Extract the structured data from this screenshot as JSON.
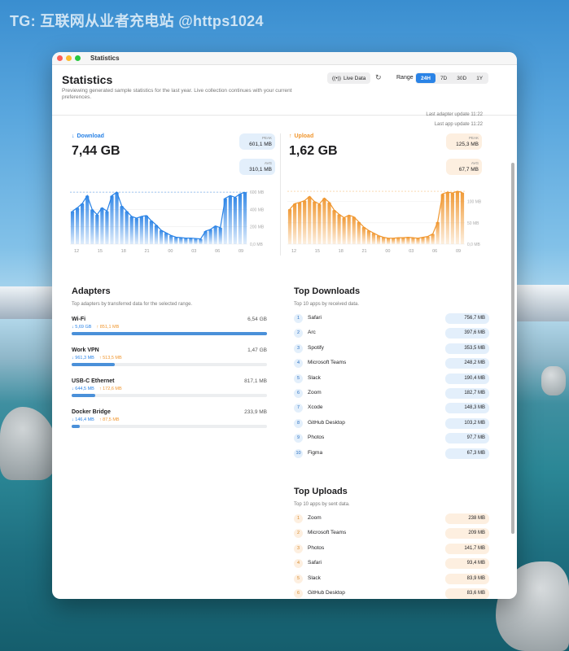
{
  "watermark": "TG: 互联网从业者充电站 @https1024",
  "window": {
    "title": "Statistics"
  },
  "header": {
    "title": "Statistics",
    "desc": "Previewing generated sample statistics for the last year. Live collection continues with your current preferences.",
    "live_label": "Live Data",
    "range_label": "Range",
    "ranges": [
      "24H",
      "7D",
      "30D",
      "1Y"
    ],
    "active_range": "24H",
    "last_adapter": "Last adapter update 11:22",
    "last_app": "Last app update 11:22"
  },
  "download": {
    "label": "Download",
    "total": "7,44 GB",
    "peak_label": "PEAK",
    "peak": "601,1 MB",
    "avg_label": "AVG",
    "avg": "310,1 MB",
    "y_ticks": [
      "600 MB",
      "400 MB",
      "200 MB",
      "0,0 MB"
    ],
    "x_ticks": [
      "12",
      "15",
      "18",
      "21",
      "00",
      "03",
      "06",
      "09"
    ],
    "values": [
      380,
      420,
      470,
      560,
      400,
      340,
      420,
      380,
      560,
      600,
      440,
      380,
      320,
      300,
      320,
      330,
      270,
      220,
      160,
      130,
      100,
      80,
      75,
      70,
      70,
      65,
      60,
      150,
      170,
      210,
      190,
      530,
      560,
      540,
      580,
      600
    ]
  },
  "upload": {
    "label": "Upload",
    "total": "1,62 GB",
    "peak_label": "PEAK",
    "peak": "125,3 MB",
    "avg_label": "AVG",
    "avg": "67,7 MB",
    "y_ticks": [
      "100 MB",
      "50 MB",
      "0,0 MB"
    ],
    "x_ticks": [
      "12",
      "15",
      "18",
      "21",
      "00",
      "03",
      "06",
      "09"
    ],
    "values": [
      82,
      95,
      98,
      102,
      112,
      100,
      94,
      108,
      98,
      80,
      70,
      62,
      68,
      64,
      52,
      40,
      32,
      26,
      20,
      16,
      14,
      14,
      15,
      15,
      16,
      15,
      14,
      16,
      18,
      24,
      52,
      118,
      122,
      120,
      124,
      121
    ]
  },
  "adapters": {
    "title": "Adapters",
    "sub": "Top adapters by transferred data for the selected range.",
    "items": [
      {
        "name": "Wi-Fi",
        "total": "6,54 GB",
        "down": "5,69 GB",
        "up": "851,1 MB",
        "fill": 1.0
      },
      {
        "name": "Work VPN",
        "total": "1,47 GB",
        "down": "961,3 MB",
        "up": "513,5 MB",
        "fill": 0.22
      },
      {
        "name": "USB-C Ethernet",
        "total": "817,1 MB",
        "down": "644,5 MB",
        "up": "172,6 MB",
        "fill": 0.12
      },
      {
        "name": "Docker Bridge",
        "total": "233,9 MB",
        "down": "146,4 MB",
        "up": "87,5 MB",
        "fill": 0.04
      }
    ]
  },
  "top_downloads": {
    "title": "Top Downloads",
    "sub": "Top 10 apps by received data.",
    "items": [
      [
        "1",
        "Safari",
        "756,7 MB"
      ],
      [
        "2",
        "Arc",
        "397,6 MB"
      ],
      [
        "3",
        "Spotify",
        "353,5 MB"
      ],
      [
        "4",
        "Microsoft Teams",
        "248,2 MB"
      ],
      [
        "5",
        "Slack",
        "190,4 MB"
      ],
      [
        "6",
        "Zoom",
        "182,7 MB"
      ],
      [
        "7",
        "Xcode",
        "148,3 MB"
      ],
      [
        "8",
        "GitHub Desktop",
        "103,2 MB"
      ],
      [
        "9",
        "Photos",
        "97,7 MB"
      ],
      [
        "10",
        "Figma",
        "67,3 MB"
      ]
    ]
  },
  "top_uploads": {
    "title": "Top Uploads",
    "sub": "Top 10 apps by sent data.",
    "items": [
      [
        "1",
        "Zoom",
        "238 MB"
      ],
      [
        "2",
        "Microsoft Teams",
        "209 MB"
      ],
      [
        "3",
        "Photos",
        "141,7 MB"
      ],
      [
        "4",
        "Safari",
        "93,4 MB"
      ],
      [
        "5",
        "Slack",
        "83,9 MB"
      ],
      [
        "6",
        "GitHub Desktop",
        "83,6 MB"
      ]
    ]
  },
  "colors": {
    "download": "#2a83e6",
    "upload": "#f0962e"
  }
}
